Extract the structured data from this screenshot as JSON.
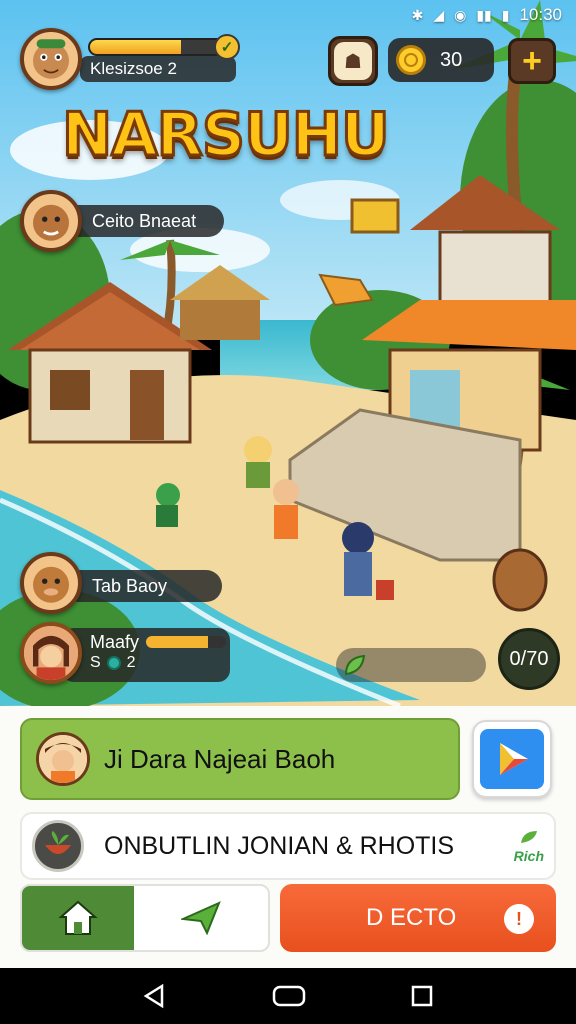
{
  "status_bar": {
    "time": "10:30",
    "icons": [
      "bluetooth-icon",
      "signal-icon",
      "alarm-icon",
      "signal-icon",
      "battery-icon"
    ]
  },
  "hud": {
    "player_name": "Klesizsoe 2",
    "xp_progress": 0.62,
    "coins": "30",
    "shop_icon": "shop-icon",
    "add_icon": "plus-icon"
  },
  "title": "NARSUHU",
  "npcs": [
    {
      "name": "Ceito Bnaeat"
    },
    {
      "name": "Tab Baoy"
    }
  ],
  "friend": {
    "name": "Maafy",
    "level": "S",
    "gems": "2",
    "progress": 0.78
  },
  "timer": "0/70",
  "panel": {
    "quest_label": "Ji  Dara Najeai Baoh",
    "news_label": "ONBUTLIN JONIAN & RHOTIS",
    "news_badge": "Rich",
    "action_label": "D ECTO",
    "action_info": "!"
  },
  "colors": {
    "quest_green": "#8dc04a",
    "home_green": "#4f8a36",
    "action_orange": "#f0582a",
    "title_gold": "#ffc316"
  }
}
